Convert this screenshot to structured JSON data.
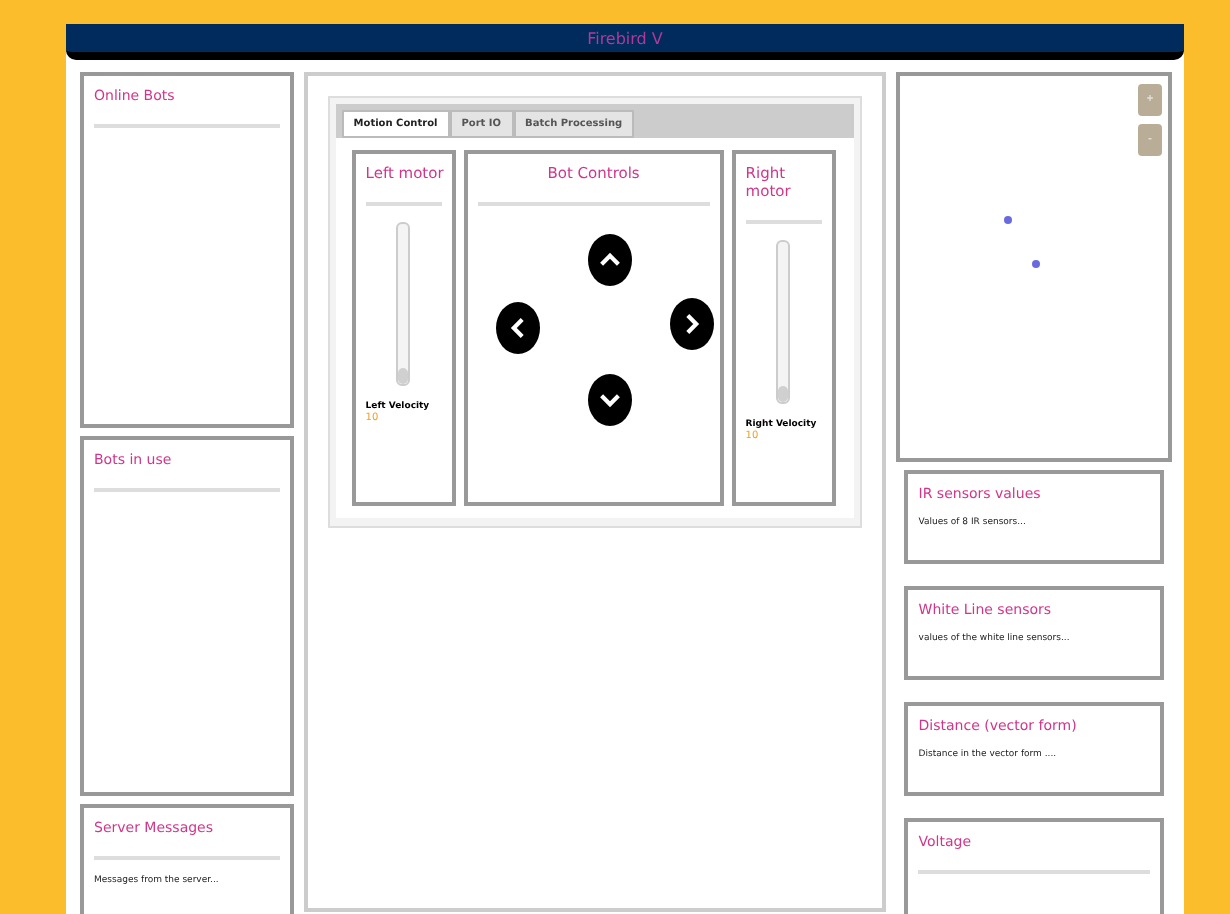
{
  "header": {
    "title": "Firebird V"
  },
  "left_panels": [
    {
      "title": "Online Bots"
    },
    {
      "title": "Bots in use"
    },
    {
      "title": "Server Messages",
      "text": "Messages from the server..."
    }
  ],
  "tabs": [
    {
      "label": "Motion Control",
      "selected": true
    },
    {
      "label": "Port IO",
      "selected": false
    },
    {
      "label": "Batch Processing",
      "selected": false
    }
  ],
  "left_motor": {
    "title": "Left motor",
    "velocity_label": "Left Velocity",
    "velocity": "10",
    "level": 0.1
  },
  "bot_controls": {
    "title": "Bot Controls"
  },
  "right_motor": {
    "title": "Right motor",
    "velocity_label": "Right Velocity",
    "velocity": "10",
    "level": 0.1
  },
  "map": {
    "zoom_in": "+",
    "zoom_out": "-"
  },
  "right_panels": [
    {
      "title": "IR sensors values",
      "text": "Values of 8 IR sensors..."
    },
    {
      "title": "White Line sensors",
      "text": "values of the white line sensors..."
    },
    {
      "title": "Distance (vector form)",
      "text": "Distance in the vector form ...."
    },
    {
      "title": "Voltage"
    }
  ]
}
